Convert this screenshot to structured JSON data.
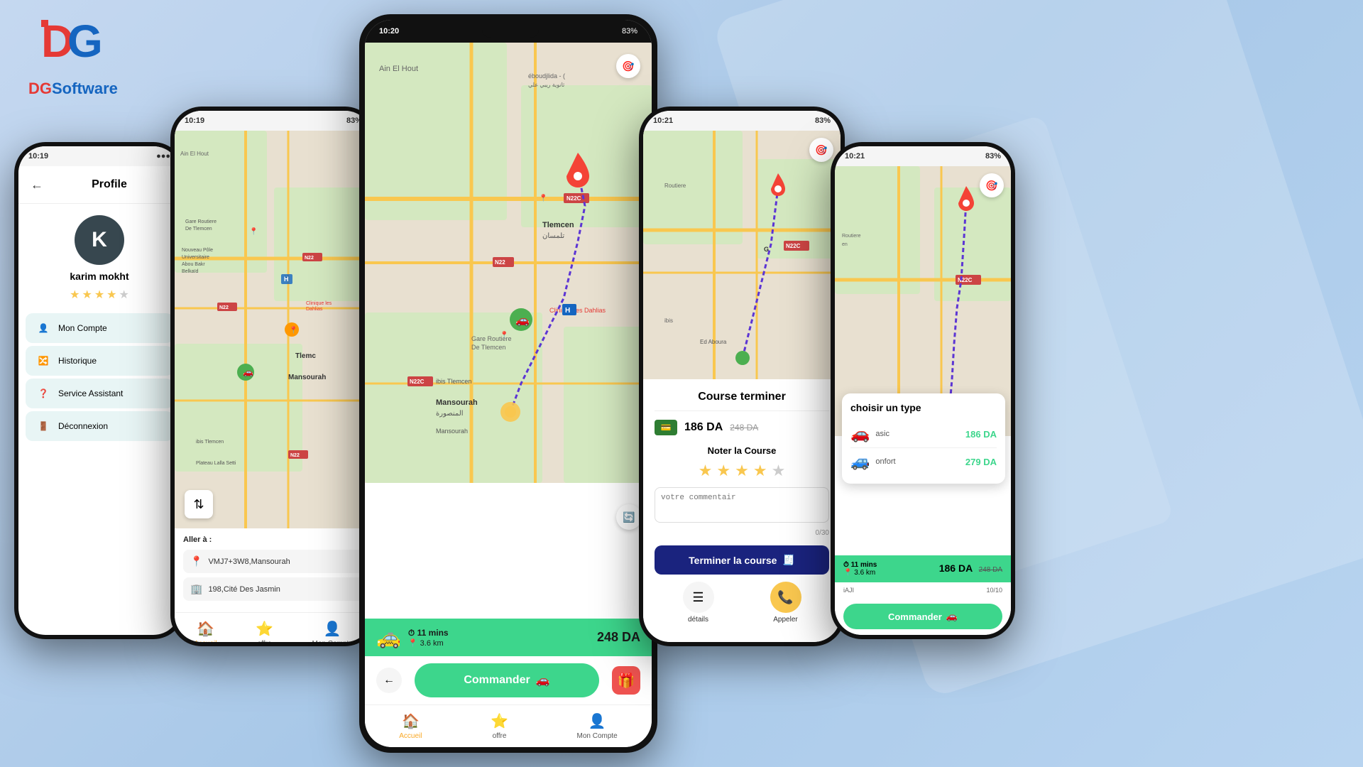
{
  "brand": {
    "name": "DGSoftware",
    "dg": "DG",
    "software": "Software"
  },
  "phone_profile": {
    "title": "Profile",
    "avatar_letter": "K",
    "user_name": "karim mokht",
    "rating": 4,
    "max_rating": 5,
    "menu_items": [
      {
        "label": "Mon Compte",
        "icon": "👤"
      },
      {
        "label": "Historique",
        "icon": "🔀"
      },
      {
        "label": "Service Assistant",
        "icon": "❓"
      },
      {
        "label": "Déconnexion",
        "icon": "🚪"
      }
    ]
  },
  "phone_map1": {
    "city": "Ain El Hout",
    "destination_label": "Aller à :",
    "dest1": "VMJ7+3W8,Mansourah",
    "dest2": "198,Cité Des Jasmin",
    "area1": "Gare Routiere De Tlemcen",
    "area2": "Nouveau Pôle Universitaire Abou Bakr Belkaïd",
    "area3": "Tlemc",
    "area4": "Mansourah"
  },
  "phone_main": {
    "status_time": "10:20",
    "status_battery": "83%",
    "city": "Ain El Hout",
    "city2": "Tlemcen",
    "trip_time": "11 mins",
    "trip_dist": "3.6 km",
    "trip_price": "248 DA",
    "commander_label": "Commander"
  },
  "phone_course": {
    "modal_title": "Course terminer",
    "price_main": "186 DA",
    "price_old": "248 DA",
    "noter_label": "Noter la Course",
    "rating": 4,
    "max_rating": 5,
    "comment_placeholder": "votre commentair",
    "comment_count": "0/30",
    "terminer_btn": "Terminer la course",
    "details_label": "détails",
    "appeler_label": "Appeler"
  },
  "phone_type": {
    "panel_title": "choisir un type",
    "types": [
      {
        "name": "asic",
        "price": "186 DA",
        "icon": "🚗"
      },
      {
        "name": "onfort",
        "price": "279 DA",
        "icon": "🚙"
      }
    ],
    "trip_time": "11 mins",
    "trip_dist": "3.6 km",
    "trip_price": "186 DA",
    "trip_price_old": "248 DA",
    "commander_label": "Commander"
  },
  "nav_labels": {
    "accueil": "Accueil",
    "offre": "offre",
    "mon_compte": "Mon Compte"
  }
}
